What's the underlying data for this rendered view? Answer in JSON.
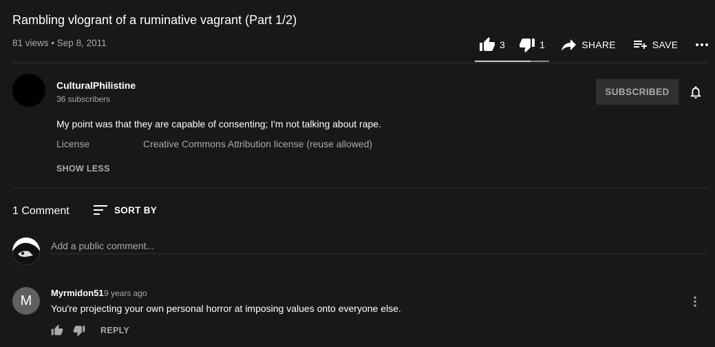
{
  "video": {
    "title": "Rambling vlogrant of a ruminative vagrant (Part 1/2)",
    "views": "81 views",
    "separator": "•",
    "date": "Sep 8, 2011",
    "like_count": "3",
    "dislike_count": "1",
    "share_label": "SHARE",
    "save_label": "SAVE",
    "like_ratio": 0.75
  },
  "channel": {
    "name": "CulturalPhilistine",
    "subscribers": "36 subscribers",
    "subscribe_label": "SUBSCRIBED"
  },
  "description": {
    "text": "My point was that they are capable of consenting; I'm not talking about rape.",
    "license_label": "License",
    "license_value": "Creative Commons Attribution license (reuse allowed)",
    "show_less": "SHOW LESS"
  },
  "comments": {
    "count_label": "1 Comment",
    "sort_label": "SORT BY",
    "input_placeholder": "Add a public comment...",
    "items": [
      {
        "avatar_letter": "M",
        "author": "Myrmidon51",
        "time": "9 years ago",
        "text": "You're projecting your own personal horror at imposing values onto everyone else.",
        "reply_label": "REPLY"
      }
    ]
  },
  "icons": {
    "like": "thumb-up-icon",
    "dislike": "thumb-down-icon",
    "share": "share-arrow-icon",
    "save": "playlist-add-icon",
    "more": "more-horizontal-icon",
    "bell": "bell-icon",
    "sort": "sort-icon",
    "comment_menu": "more-vertical-icon"
  },
  "colors": {
    "background": "#181818",
    "text_primary": "#ffffff",
    "text_secondary": "#aaaaaa",
    "divider": "#303030",
    "subscribed_button": "#303030"
  }
}
